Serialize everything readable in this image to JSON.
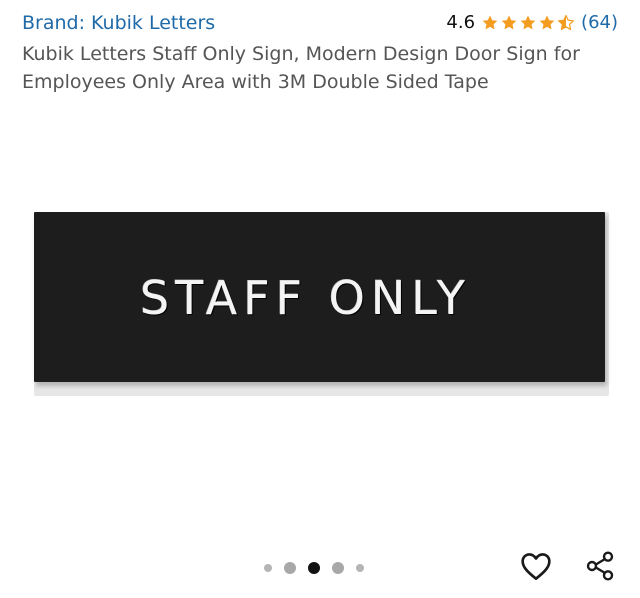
{
  "product": {
    "brand_label": "Brand: Kubik Letters",
    "rating_value": "4.6",
    "rating_stars": 4.5,
    "review_count": "(64)",
    "title": "Kubik Letters Staff Only Sign, Modern Design Door Sign for Employees Only Area with 3M Double Sided Tape"
  },
  "image": {
    "sign_text": "STAFF ONLY",
    "board_color": "#1d1d1d"
  },
  "carousel": {
    "total_dots": 5,
    "active_index": 2
  },
  "actions": {
    "wishlist_icon": "heart-icon",
    "share_icon": "share-icon"
  },
  "colors": {
    "link": "#1f6aa8",
    "star": "#f39c1f",
    "title": "#555555"
  }
}
